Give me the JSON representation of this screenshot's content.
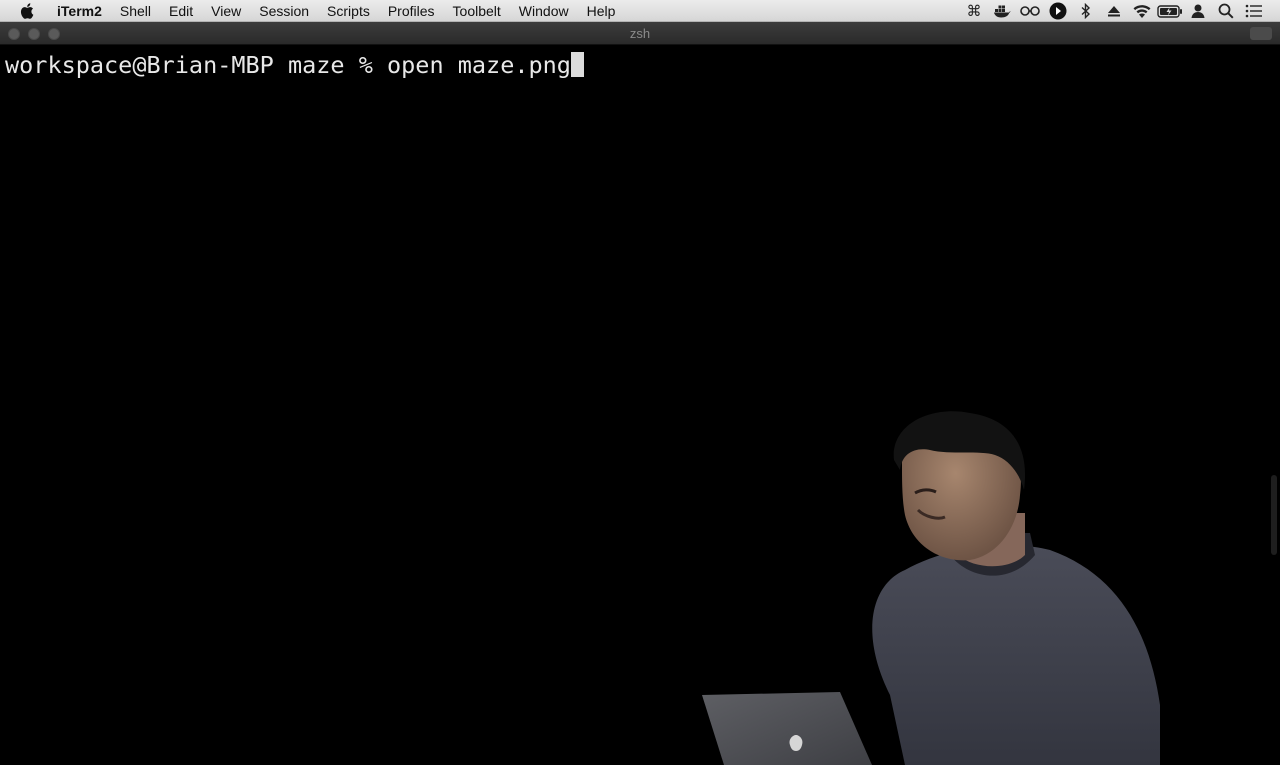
{
  "menubar": {
    "app_name": "iTerm2",
    "items": [
      "Shell",
      "Edit",
      "View",
      "Session",
      "Scripts",
      "Profiles",
      "Toolbelt",
      "Window",
      "Help"
    ],
    "status_icons": [
      "command-key-icon",
      "docker-icon",
      "glasses-icon",
      "play-circle-icon",
      "bluetooth-icon",
      "eject-icon",
      "wifi-icon",
      "battery-icon",
      "user-icon",
      "search-icon",
      "notification-center-icon"
    ]
  },
  "window": {
    "title": "zsh"
  },
  "terminal": {
    "prompt": "workspace@Brian-MBP maze % ",
    "command": "open maze.png"
  },
  "colors": {
    "terminal_bg": "#000000",
    "terminal_fg": "#e8e8e8",
    "menubar_bg": "#e0e0e0",
    "titlebar_bg": "#333333"
  }
}
